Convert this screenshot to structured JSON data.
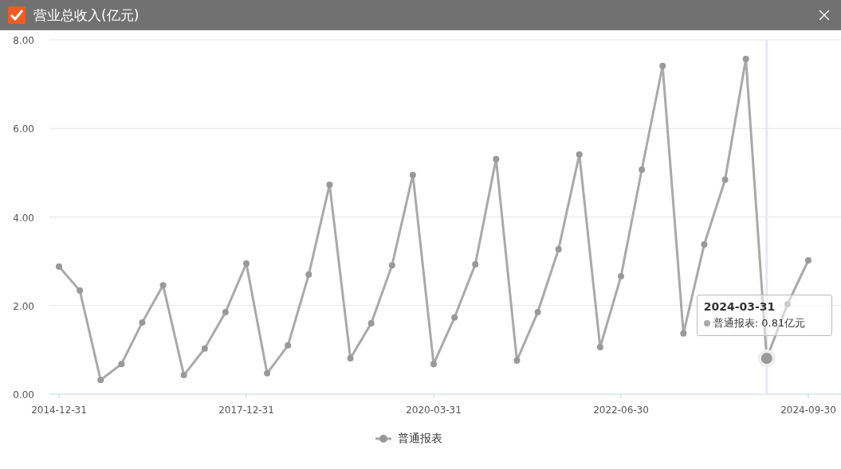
{
  "window": {
    "title": "营业总收入(亿元)"
  },
  "chart_data": {
    "type": "line",
    "grid": true,
    "categories": [
      "2014-12-31",
      null,
      null,
      null,
      null,
      null,
      null,
      null,
      null,
      "2017-12-31",
      null,
      null,
      null,
      null,
      null,
      null,
      null,
      null,
      "2020-03-31",
      null,
      null,
      null,
      null,
      null,
      null,
      null,
      null,
      "2022-06-30",
      null,
      null,
      null,
      null,
      null,
      null,
      null,
      null,
      "2024-09-30"
    ],
    "series": [
      {
        "name": "普通报表",
        "color": "#a9a9a9",
        "marker": "circle",
        "values": [
          2.88,
          2.34,
          0.32,
          0.68,
          1.62,
          2.46,
          0.43,
          1.03,
          1.85,
          2.95,
          0.47,
          1.1,
          2.7,
          4.73,
          0.81,
          1.6,
          2.91,
          4.95,
          0.68,
          1.73,
          2.93,
          5.31,
          0.76,
          1.85,
          3.27,
          5.41,
          1.06,
          2.66,
          5.07,
          7.41,
          1.37,
          3.38,
          4.84,
          7.57,
          0.81,
          2.03,
          3.02
        ]
      }
    ],
    "ylim": [
      0,
      8
    ],
    "yticks": [
      {
        "value": 0,
        "label": "0.00"
      },
      {
        "value": 2,
        "label": "2.00"
      },
      {
        "value": 4,
        "label": "4.00"
      },
      {
        "value": 6,
        "label": "6.00"
      },
      {
        "value": 8,
        "label": "8.00"
      }
    ]
  },
  "points": [
    {
      "hovered": false
    },
    {
      "hovered": false
    },
    {
      "hovered": false
    },
    {
      "hovered": false
    },
    {
      "hovered": false
    },
    {
      "hovered": false
    },
    {
      "hovered": false
    },
    {
      "hovered": false
    },
    {
      "hovered": false
    },
    {
      "hovered": false
    },
    {
      "hovered": false
    },
    {
      "hovered": false
    },
    {
      "hovered": false
    },
    {
      "hovered": false
    },
    {
      "hovered": false
    },
    {
      "hovered": false
    },
    {
      "hovered": false
    },
    {
      "hovered": false
    },
    {
      "hovered": false
    },
    {
      "hovered": false
    },
    {
      "hovered": false
    },
    {
      "hovered": false
    },
    {
      "hovered": false
    },
    {
      "hovered": false
    },
    {
      "hovered": false
    },
    {
      "hovered": false
    },
    {
      "hovered": false
    },
    {
      "hovered": false
    },
    {
      "hovered": false
    },
    {
      "hovered": false
    },
    {
      "hovered": false
    },
    {
      "hovered": false
    },
    {
      "hovered": false
    },
    {
      "hovered": false
    },
    {
      "hovered": true
    },
    {
      "hovered": false
    },
    {
      "hovered": false
    }
  ],
  "tooltip": {
    "date": "2024-03-31",
    "text": "普通报表: 0.81亿元"
  }
}
